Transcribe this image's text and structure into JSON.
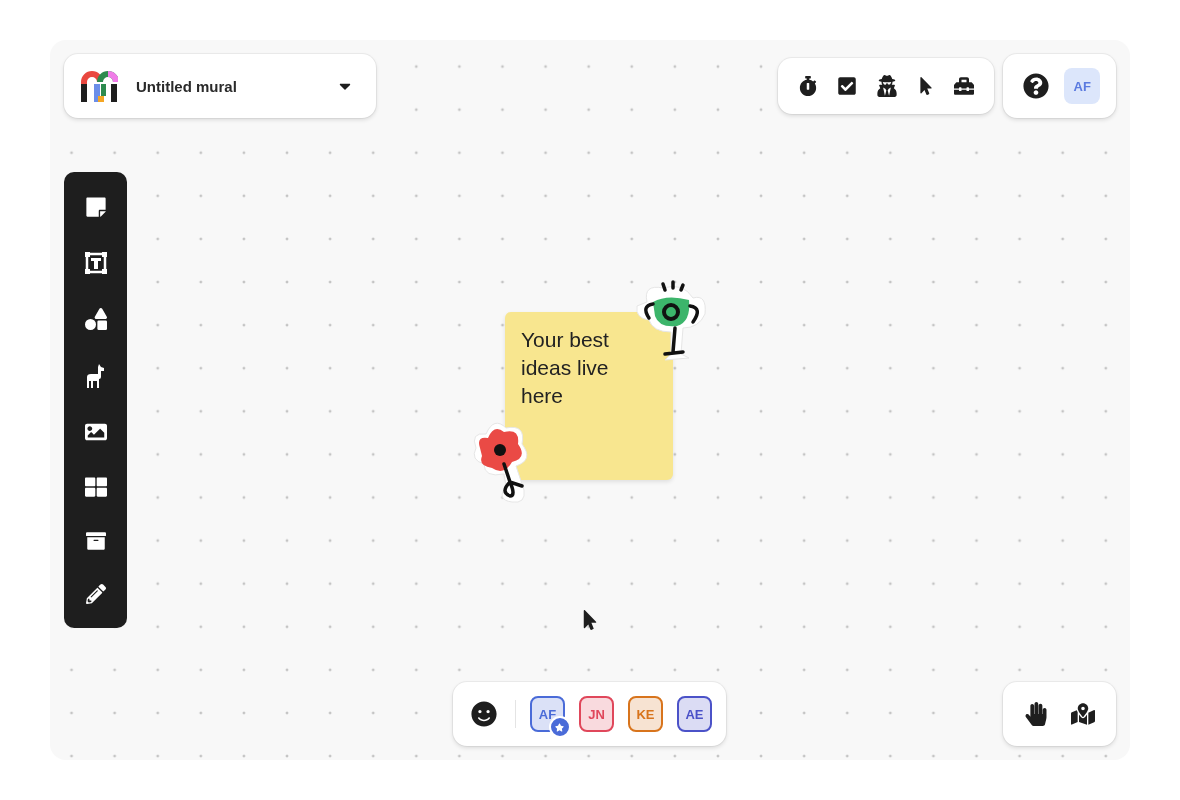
{
  "mural": {
    "title": "Untitled mural"
  },
  "account": {
    "initials": "AF"
  },
  "sticky_note": {
    "text": "Your best ideas live here"
  },
  "collaborators": [
    {
      "initials": "AF",
      "color": "#4a6bd8",
      "host": true
    },
    {
      "initials": "JN",
      "color": "#e0475b",
      "host": false
    },
    {
      "initials": "KE",
      "color": "#d8741c",
      "host": false
    },
    {
      "initials": "AE",
      "color": "#4b52c8",
      "host": false
    }
  ]
}
